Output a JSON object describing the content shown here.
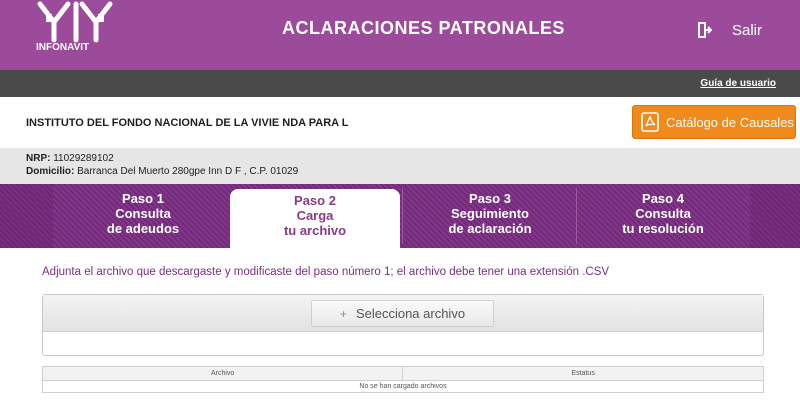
{
  "header": {
    "logo_text": "INFONAVIT",
    "title": "ACLARACIONES PATRONALES",
    "logout_label": "Salir",
    "logout_icon": "logout-icon"
  },
  "guide_link": "Guía de usuario",
  "employer_name": "INSTITUTO DEL FONDO NACIONAL DE LA VIVIE NDA PARA L",
  "catalog_button": {
    "label": "Catálogo de Causales",
    "icon": "pdf-icon"
  },
  "info": {
    "nrp_label": "NRP:",
    "nrp_value": "11029289102",
    "domicilio_label": "Domicilio:",
    "domicilio_value": "Barranca Del Muerto 280gpe Inn D F , C.P. 01029"
  },
  "steps": [
    {
      "line1": "Paso 1",
      "line2": "Consulta",
      "line3": "de adeudos",
      "active": false
    },
    {
      "line1": "Paso 2",
      "line2": "Carga",
      "line3": "tu archivo",
      "active": true
    },
    {
      "line1": "Paso 3",
      "line2": "Seguimiento",
      "line3": "de aclaración",
      "active": false
    },
    {
      "line1": "Paso 4",
      "line2": "Consulta",
      "line3": "tu resolución",
      "active": false
    }
  ],
  "instruction": "Adjunta el archivo que descargaste y modificaste del paso número 1; el archivo debe tener una extensión .CSV",
  "upload": {
    "button_label": "Selecciona archivo",
    "icon": "plus-icon"
  },
  "files_table": {
    "columns": [
      "Archivo",
      "Estatus"
    ],
    "empty_message": "No se han cargado archivos"
  },
  "colors": {
    "brand_purple": "#9c4b9a",
    "dark_bar": "#4a4a4a",
    "accent_orange": "#f08a1c",
    "step_purple": "#722a78"
  }
}
